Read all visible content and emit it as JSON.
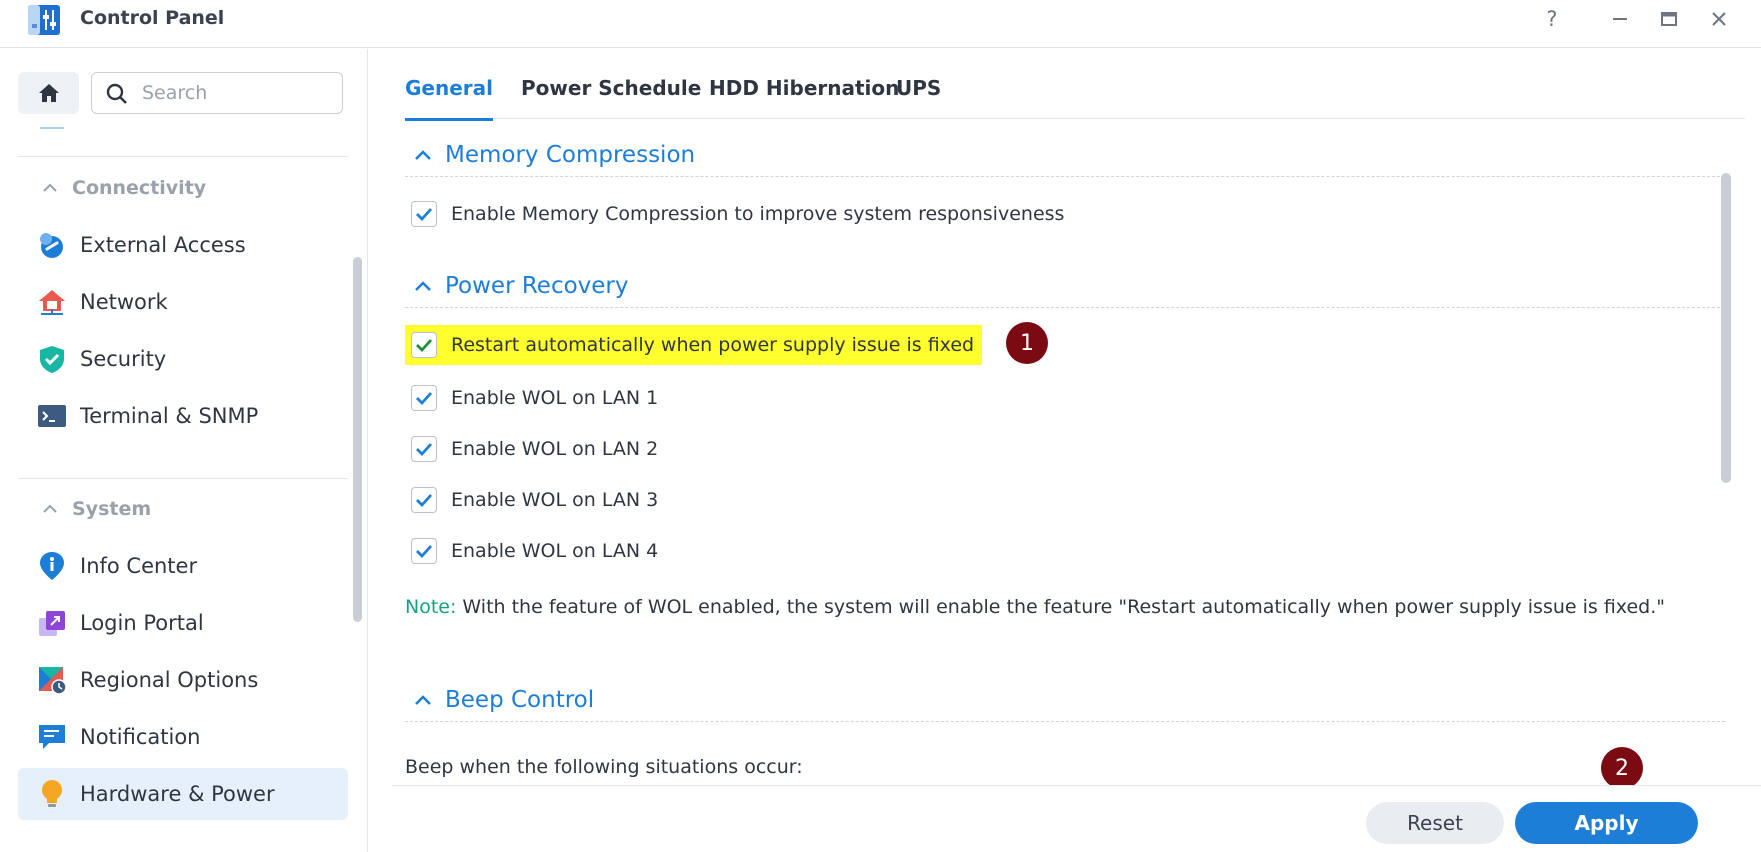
{
  "window": {
    "title": "Control Panel",
    "controls": {
      "help": "?",
      "minimize": "—",
      "maximize": "□",
      "close": "✕"
    }
  },
  "sidebar": {
    "search_placeholder": "Search",
    "groups": [
      {
        "title": "Connectivity",
        "items": [
          {
            "label": "External Access",
            "icon": "external-access-icon"
          },
          {
            "label": "Network",
            "icon": "network-house-icon"
          },
          {
            "label": "Security",
            "icon": "shield-check-icon"
          },
          {
            "label": "Terminal & SNMP",
            "icon": "terminal-icon"
          }
        ]
      },
      {
        "title": "System",
        "items": [
          {
            "label": "Info Center",
            "icon": "info-icon"
          },
          {
            "label": "Login Portal",
            "icon": "login-portal-icon"
          },
          {
            "label": "Regional Options",
            "icon": "regional-options-icon"
          },
          {
            "label": "Notification",
            "icon": "notification-icon"
          },
          {
            "label": "Hardware & Power",
            "icon": "lightbulb-icon",
            "active": true
          }
        ]
      }
    ]
  },
  "tabs": [
    {
      "label": "General",
      "active": true
    },
    {
      "label": "Power Schedule"
    },
    {
      "label": "HDD Hibernation"
    },
    {
      "label": "UPS"
    }
  ],
  "sections": {
    "memory": {
      "title": "Memory Compression",
      "options": [
        {
          "label": "Enable Memory Compression to improve system responsiveness",
          "checked": true
        }
      ]
    },
    "power_recovery": {
      "title": "Power Recovery",
      "options": [
        {
          "label": "Restart automatically when power supply issue is fixed",
          "checked": true,
          "highlighted": true
        },
        {
          "label": "Enable WOL on LAN 1",
          "checked": true
        },
        {
          "label": "Enable WOL on LAN 2",
          "checked": true
        },
        {
          "label": "Enable WOL on LAN 3",
          "checked": true
        },
        {
          "label": "Enable WOL on LAN 4",
          "checked": true
        }
      ],
      "note_label": "Note:",
      "note_text": " With the feature of WOL enabled, the system will enable the feature \"Restart automatically when power supply issue is fixed.\""
    },
    "beep": {
      "title": "Beep Control",
      "text": "Beep when the following situations occur:"
    }
  },
  "annotations": {
    "step1": "1",
    "step2": "2"
  },
  "footer": {
    "reset_label": "Reset",
    "apply_label": "Apply"
  },
  "colors": {
    "accent": "#1d7ed8",
    "highlight": "#ffff2e",
    "badge": "#7c0a12",
    "note": "#14a37f"
  }
}
